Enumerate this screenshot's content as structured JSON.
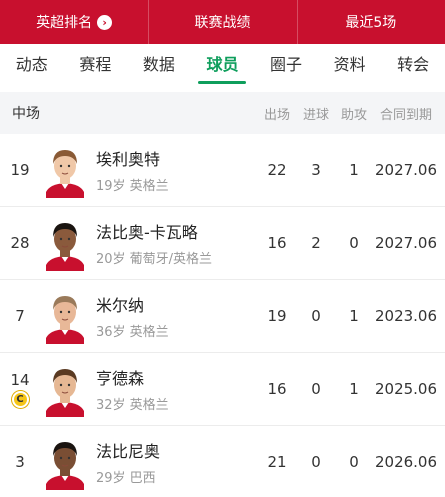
{
  "topbar": {
    "items": [
      "英超排名",
      "联赛战绩",
      "最近5场"
    ],
    "arrow_glyph": "›"
  },
  "tabs": [
    "动态",
    "赛程",
    "数据",
    "球员",
    "圈子",
    "资料",
    "转会"
  ],
  "active_tab": "球员",
  "section": {
    "title": "中场",
    "columns": [
      "出场",
      "进球",
      "助攻",
      "合同到期"
    ]
  },
  "players": [
    {
      "number": "19",
      "name": "埃利奥特",
      "info": "19岁 英格兰",
      "apps": "22",
      "goals": "3",
      "assists": "1",
      "contract": "2027.06",
      "captain": false,
      "hair": "#8a5a35",
      "skin": "#f0c8a8"
    },
    {
      "number": "28",
      "name": "法比奥-卡瓦略",
      "info": "20岁 葡萄牙/英格兰",
      "apps": "16",
      "goals": "2",
      "assists": "0",
      "contract": "2027.06",
      "captain": false,
      "hair": "#1a1410",
      "skin": "#8a5a3c"
    },
    {
      "number": "7",
      "name": "米尔纳",
      "info": "36岁 英格兰",
      "apps": "19",
      "goals": "0",
      "assists": "1",
      "contract": "2023.06",
      "captain": false,
      "hair": "#9a7a5a",
      "skin": "#e8b898"
    },
    {
      "number": "14",
      "name": "亨德森",
      "info": "32岁 英格兰",
      "apps": "16",
      "goals": "0",
      "assists": "1",
      "contract": "2025.06",
      "captain": true,
      "captain_label": "C",
      "hair": "#5a3a22",
      "skin": "#e6b894"
    },
    {
      "number": "3",
      "name": "法比尼奥",
      "info": "29岁 巴西",
      "apps": "21",
      "goals": "0",
      "assists": "0",
      "contract": "2026.06",
      "captain": false,
      "hair": "#1a1410",
      "skin": "#7a4e34"
    }
  ],
  "colors": {
    "brand_red": "#c8102e",
    "active_green": "#0e9e5c",
    "kit_red": "#c8102e"
  }
}
